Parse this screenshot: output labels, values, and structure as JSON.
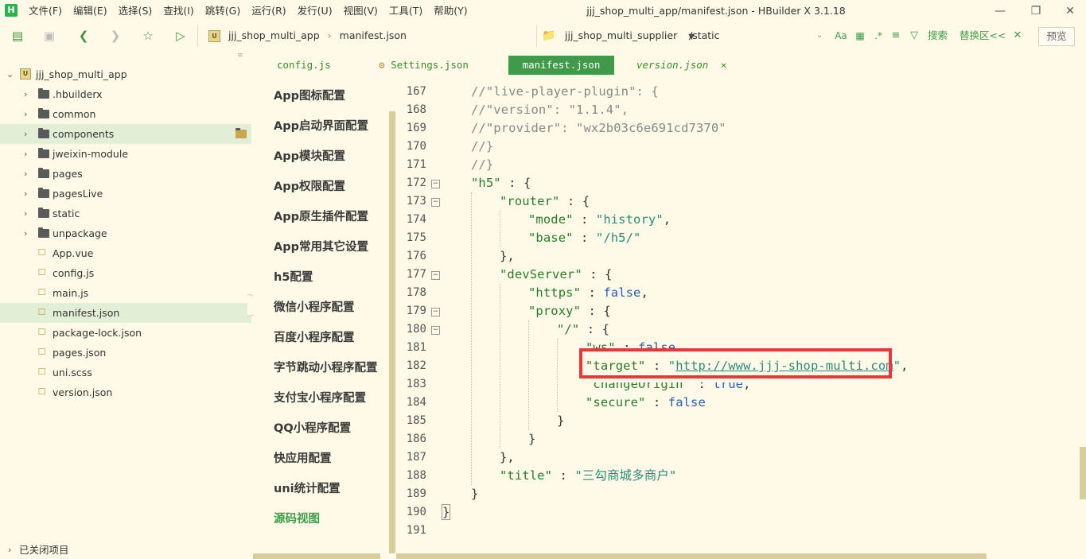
{
  "menubar": {
    "logo": "H",
    "items": [
      "文件(F)",
      "编辑(E)",
      "选择(S)",
      "查找(I)",
      "跳转(G)",
      "运行(R)",
      "发行(U)",
      "视图(V)",
      "工具(T)",
      "帮助(Y)"
    ],
    "window_title": "jjj_shop_multi_app/manifest.json - HBuilder X 3.1.18"
  },
  "toolbar": {
    "breadcrumb": [
      "jjj_shop_multi_app",
      "manifest.json"
    ],
    "project_selector": "jjj_shop_multi_supplier",
    "path_field": "/static",
    "search_label": "搜索",
    "replace_label": "替换区<<",
    "preview_label": "预览"
  },
  "sidebar": {
    "root": "jjj_shop_multi_app",
    "items": [
      {
        "label": ".hbuilderx",
        "kind": "folder"
      },
      {
        "label": "common",
        "kind": "folder"
      },
      {
        "label": "components",
        "kind": "folder"
      },
      {
        "label": "jweixin-module",
        "kind": "folder"
      },
      {
        "label": "pages",
        "kind": "folder"
      },
      {
        "label": "pagesLive",
        "kind": "folder"
      },
      {
        "label": "static",
        "kind": "folder"
      },
      {
        "label": "unpackage",
        "kind": "folder"
      },
      {
        "label": "App.vue",
        "kind": "file"
      },
      {
        "label": "config.js",
        "kind": "file"
      },
      {
        "label": "main.js",
        "kind": "file"
      },
      {
        "label": "manifest.json",
        "kind": "file"
      },
      {
        "label": "package-lock.json",
        "kind": "file"
      },
      {
        "label": "pages.json",
        "kind": "file"
      },
      {
        "label": "uni.scss",
        "kind": "file"
      },
      {
        "label": "version.json",
        "kind": "file"
      }
    ],
    "closed_projects": "已关闭项目"
  },
  "tabs": [
    {
      "label": "config.js"
    },
    {
      "label": "Settings.json"
    },
    {
      "label": "manifest.json"
    },
    {
      "label": "version.json"
    }
  ],
  "config_nav": [
    "App图标配置",
    "App启动界面配置",
    "App模块配置",
    "App权限配置",
    "App原生插件配置",
    "App常用其它设置",
    "h5配置",
    "微信小程序配置",
    "百度小程序配置",
    "字节跳动小程序配置",
    "支付宝小程序配置",
    "QQ小程序配置",
    "快应用配置",
    "uni统计配置",
    "源码视图"
  ],
  "editor": {
    "lines": [
      {
        "n": "167",
        "text": "//\"live-player-plugin\": {"
      },
      {
        "n": "168",
        "text": "//\"version\": \"1.1.4\","
      },
      {
        "n": "169",
        "text": "//\"provider\": \"wx2b03c6e691cd7370\""
      },
      {
        "n": "170",
        "text": "//}"
      },
      {
        "n": "171",
        "text": "//}"
      },
      {
        "n": "172",
        "text": "\"h5\" : {"
      },
      {
        "n": "173",
        "text": "\"router\" : {"
      },
      {
        "n": "174",
        "text": "\"mode\" : \"history\","
      },
      {
        "n": "175",
        "text": "\"base\" : \"/h5/\""
      },
      {
        "n": "176",
        "text": "},"
      },
      {
        "n": "177",
        "text": "\"devServer\" : {"
      },
      {
        "n": "178",
        "text": "\"https\" : false,"
      },
      {
        "n": "179",
        "text": "\"proxy\" : {"
      },
      {
        "n": "180",
        "text": "\"/\" : {"
      },
      {
        "n": "181",
        "text": "\"ws\" : false,"
      },
      {
        "n": "182",
        "text": "\"target\" : \"http://www.jjj-shop-multi.com\","
      },
      {
        "n": "183",
        "text": "\"changeOrigin\" : true,"
      },
      {
        "n": "184",
        "text": "\"secure\" : false"
      },
      {
        "n": "185",
        "text": "}"
      },
      {
        "n": "186",
        "text": "}"
      },
      {
        "n": "187",
        "text": "},"
      },
      {
        "n": "188",
        "text": "\"title\" : \"三勾商城多商户\""
      },
      {
        "n": "189",
        "text": "}"
      },
      {
        "n": "190",
        "text": "}"
      },
      {
        "n": "191",
        "text": ""
      }
    ],
    "tokens": {
      "h5": "\"h5\"",
      "router": "\"router\"",
      "mode": "\"mode\"",
      "history": "\"history\"",
      "base": "\"base\"",
      "h5path": "\"/h5/\"",
      "devServer": "\"devServer\"",
      "https": "\"https\"",
      "proxy": "\"proxy\"",
      "slash": "\"/\"",
      "ws": "\"ws\"",
      "target": "\"target\"",
      "target_url": "http://www.jjj-shop-multi.com",
      "quote": "\"",
      "changeOrigin": "\"changeOrigin\"",
      "secure": "\"secure\"",
      "title": "\"title\"",
      "title_val": "\"三勾商城多商户\"",
      "false": "false",
      "true": "true"
    }
  },
  "colors": {
    "background": "#fffae8",
    "accent": "#3f9b49",
    "highlight_box": "#e8363a"
  }
}
